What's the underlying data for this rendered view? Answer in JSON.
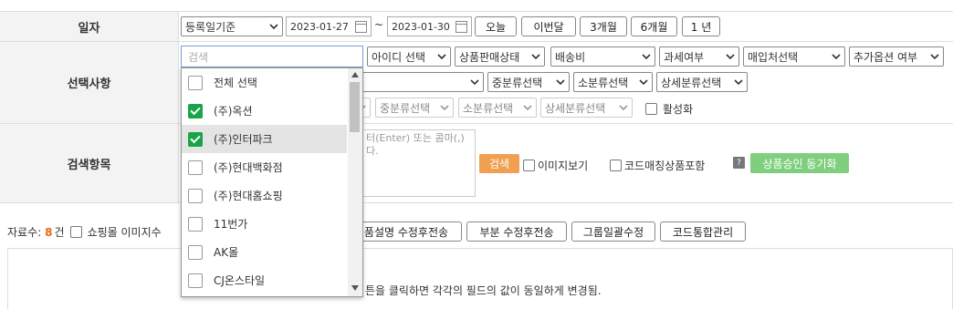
{
  "rows": {
    "date_label": "일자",
    "selection_label": "선택사항",
    "search_label": "검색항목"
  },
  "date_row": {
    "basis_select": "등록일기준",
    "start_date": "2023-01-27",
    "tilde": "~",
    "end_date": "2023-01-30",
    "buttons": [
      "오늘",
      "이번달",
      "3개월",
      "6개월",
      "1 년"
    ]
  },
  "selection_row": {
    "search_placeholder": "검색",
    "selects_top": [
      "아이디 선택",
      "상품판매상태",
      "배송비",
      "과세여부",
      "매입처선택",
      "추가옵션 여부"
    ],
    "selects_mid": [
      "중분류선택",
      "소분류선택",
      "상세분류선택"
    ],
    "selects_low": [
      "중분류선택",
      "소분류선택",
      "상세분류선택"
    ],
    "active_label": "활성화"
  },
  "search_row": {
    "textarea_hint_line1": "터(Enter) 또는 콤마(,)",
    "textarea_hint_line2": "다.",
    "search_button": "검색",
    "image_view_label": "이미지보기",
    "code_match_label": "코드매칭상품포함",
    "help_mark": "?",
    "sync_button": "상품승인 동기화"
  },
  "result_bar": {
    "count_prefix": "자료수:",
    "count_value": "8",
    "count_suffix": "건",
    "mall_image_label": "쇼핑몰 이미지수",
    "buttons": [
      "품설명 수정후전송",
      "부분 수정후전송",
      "그룹일괄수정",
      "코드통합관리"
    ]
  },
  "notice": "튼을 클릭하면 각각의 필드의 값이 동일하게 변경됨.",
  "dropdown": {
    "items": [
      {
        "label": "전체 선택",
        "checked": false
      },
      {
        "label": "(주)옥션",
        "checked": true
      },
      {
        "label": "(주)인터파크",
        "checked": true
      },
      {
        "label": "(주)현대백화점",
        "checked": false
      },
      {
        "label": "(주)현대홈쇼핑",
        "checked": false
      },
      {
        "label": "11번가",
        "checked": false
      },
      {
        "label": "AK몰",
        "checked": false
      },
      {
        "label": "CJ온스타일",
        "checked": false
      }
    ]
  },
  "colors": {
    "accent_orange": "#f0a050",
    "count_orange": "#e8650f",
    "sync_green": "#7fcf7f",
    "check_green": "#19a448",
    "label_bg": "#f3f3f3"
  }
}
